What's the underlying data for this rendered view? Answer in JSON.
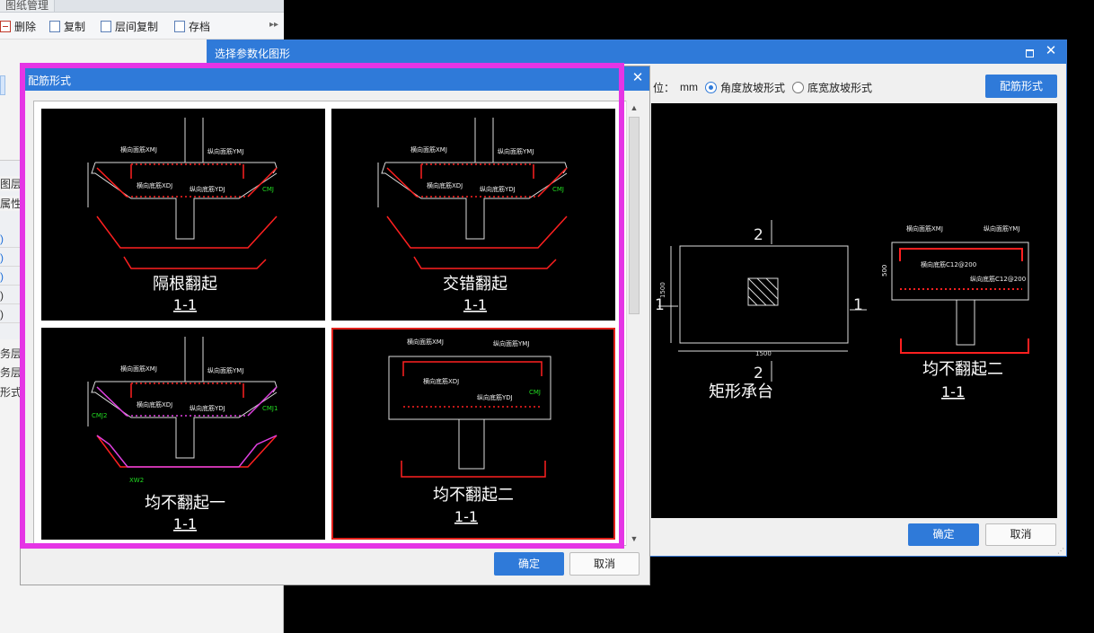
{
  "left_panel": {
    "header_tab": "图纸管理",
    "toolbar": {
      "delete_label": "删除",
      "copy_label": "复制",
      "floor_copy_label": "层间复制",
      "save_label": "存档"
    },
    "fragments": [
      "图层",
      "属性名",
      "务层",
      "务层",
      "形式"
    ],
    "row_marks": [
      ")",
      ")",
      ")",
      ")",
      ")"
    ]
  },
  "param_dialog": {
    "title": "选择参数化图形",
    "unit_label": "位：",
    "unit_value": "mm",
    "radio_angle_label": "角度放坡形式",
    "radio_width_label": "底宽放坡形式",
    "radio_selected": "角度放坡形式",
    "rebar_button_label": "配筋形式",
    "ok_label": "确定",
    "cancel_label": "取消",
    "preview": {
      "plan_caption": "矩形承台",
      "plan_section_mark_top": "2",
      "plan_section_mark_bottom": "2",
      "plan_section_mark_left": "1",
      "plan_section_mark_right": "1",
      "plan_dim_width": "1500",
      "plan_dim_height": "1500",
      "section_caption": "均不翻起二",
      "section_sub": "1-1",
      "label_top_bar": "横向面筋XMJ",
      "label_top_bar2": "纵向面筋YMJ",
      "label_bottom_bar": "横向底筋C12@200",
      "label_bottom_bar2": "纵向底筋C12@200",
      "dim_height": "500"
    }
  },
  "rebar_dialog": {
    "title": "配筋形式",
    "ok_label": "确定",
    "cancel_label": "取消",
    "selected_index": 3,
    "tiles": [
      {
        "caption": "隔根翻起",
        "sub": "1-1",
        "top_x": "横向面筋XMJ",
        "top_y": "纵向面筋YMJ",
        "bot_x": "横向底筋XDJ",
        "bot_y": "纵向底筋YDJ",
        "side": "CMJ"
      },
      {
        "caption": "交错翻起",
        "sub": "1-1",
        "top_x": "横向面筋XMJ",
        "top_y": "纵向面筋YMJ",
        "bot_x": "横向底筋XDJ",
        "bot_y": "纵向底筋YDJ",
        "side": "CMJ"
      },
      {
        "caption": "均不翻起一",
        "sub": "1-1",
        "top_x": "横向面筋XMJ",
        "top_y": "纵向面筋YMJ",
        "bot_x": "横向底筋XDJ",
        "bot_y": "纵向底筋YDJ",
        "side": "CMJ1",
        "side2": "CMJ2",
        "bottom_mark": "XW2"
      },
      {
        "caption": "均不翻起二",
        "sub": "1-1",
        "top_x": "横向面筋XMJ",
        "top_y": "纵向面筋YMJ",
        "bot_x": "横向底筋XDJ",
        "bot_y": "纵向底筋YDJ",
        "side": "CMJ"
      }
    ]
  },
  "colors": {
    "title_bar": "#2f7ad9",
    "highlight": "#e535e5",
    "selected_border": "#e0201b",
    "rebar_red": "#ff2020",
    "label_green": "#22dd22"
  }
}
